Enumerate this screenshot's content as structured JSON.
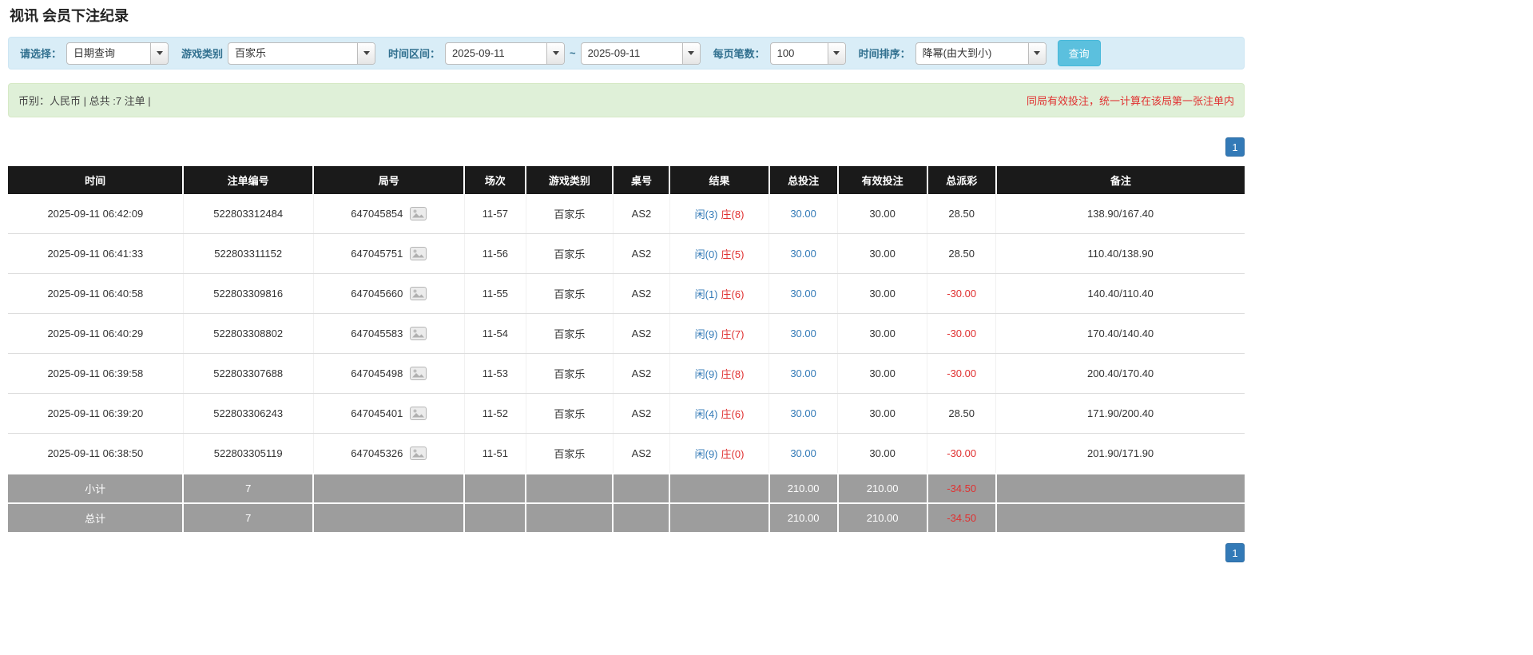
{
  "page": {
    "title": "视讯 会员下注纪录"
  },
  "colors": {
    "accent_blue": "#337ab7",
    "search_button_bg": "#5bc0de",
    "filter_bar_bg": "#d9edf7",
    "filter_label": "#31708f",
    "summary_bar_bg": "#dff0d8",
    "negative_red": "#e03131",
    "player_blue": "#337ab7",
    "banker_red": "#e03131",
    "table_header_bg": "#1a1a1a",
    "table_footer_bg": "#9d9d9d"
  },
  "filters": {
    "select_label": "请选择：",
    "select_value": "日期查询",
    "game_type_label": "游戏类别",
    "game_type_value": "百家乐",
    "date_range_label": "时间区间：",
    "date_from": "2025-09-11",
    "date_separator": "~",
    "date_to": "2025-09-11",
    "page_size_label": "每页笔数：",
    "page_size_value": "100",
    "sort_label": "时间排序：",
    "sort_value": "降幂(由大到小)",
    "search_button": "查询"
  },
  "summary": {
    "left": "币别：人民币 | 总共 :7 注单 |",
    "right": "同局有效投注，统一计算在该局第一张注单内"
  },
  "pagination": {
    "page": "1"
  },
  "table": {
    "headers": [
      "时间",
      "注单编号",
      "局号",
      "场次",
      "游戏类别",
      "桌号",
      "结果",
      "总投注",
      "有效投注",
      "总派彩",
      "备注"
    ],
    "rows": [
      {
        "time": "2025-09-11 06:42:09",
        "bet_id": "522803312484",
        "round_id": "647045854",
        "session": "11-57",
        "game": "百家乐",
        "table_no": "AS2",
        "result_player": "闲(3)",
        "result_banker": "庄(8)",
        "total_bet": "30.00",
        "valid_bet": "30.00",
        "payout": "28.50",
        "remark": "138.90/167.40"
      },
      {
        "time": "2025-09-11 06:41:33",
        "bet_id": "522803311152",
        "round_id": "647045751",
        "session": "11-56",
        "game": "百家乐",
        "table_no": "AS2",
        "result_player": "闲(0)",
        "result_banker": "庄(5)",
        "total_bet": "30.00",
        "valid_bet": "30.00",
        "payout": "28.50",
        "remark": "110.40/138.90"
      },
      {
        "time": "2025-09-11 06:40:58",
        "bet_id": "522803309816",
        "round_id": "647045660",
        "session": "11-55",
        "game": "百家乐",
        "table_no": "AS2",
        "result_player": "闲(1)",
        "result_banker": "庄(6)",
        "total_bet": "30.00",
        "valid_bet": "30.00",
        "payout": "-30.00",
        "remark": "140.40/110.40"
      },
      {
        "time": "2025-09-11 06:40:29",
        "bet_id": "522803308802",
        "round_id": "647045583",
        "session": "11-54",
        "game": "百家乐",
        "table_no": "AS2",
        "result_player": "闲(9)",
        "result_banker": "庄(7)",
        "total_bet": "30.00",
        "valid_bet": "30.00",
        "payout": "-30.00",
        "remark": "170.40/140.40"
      },
      {
        "time": "2025-09-11 06:39:58",
        "bet_id": "522803307688",
        "round_id": "647045498",
        "session": "11-53",
        "game": "百家乐",
        "table_no": "AS2",
        "result_player": "闲(9)",
        "result_banker": "庄(8)",
        "total_bet": "30.00",
        "valid_bet": "30.00",
        "payout": "-30.00",
        "remark": "200.40/170.40"
      },
      {
        "time": "2025-09-11 06:39:20",
        "bet_id": "522803306243",
        "round_id": "647045401",
        "session": "11-52",
        "game": "百家乐",
        "table_no": "AS2",
        "result_player": "闲(4)",
        "result_banker": "庄(6)",
        "total_bet": "30.00",
        "valid_bet": "30.00",
        "payout": "28.50",
        "remark": "171.90/200.40"
      },
      {
        "time": "2025-09-11 06:38:50",
        "bet_id": "522803305119",
        "round_id": "647045326",
        "session": "11-51",
        "game": "百家乐",
        "table_no": "AS2",
        "result_player": "闲(9)",
        "result_banker": "庄(0)",
        "total_bet": "30.00",
        "valid_bet": "30.00",
        "payout": "-30.00",
        "remark": "201.90/171.90"
      }
    ],
    "subtotal": {
      "label": "小计",
      "count": "7",
      "total_bet": "210.00",
      "valid_bet": "210.00",
      "payout": "-34.50"
    },
    "total": {
      "label": "总计",
      "count": "7",
      "total_bet": "210.00",
      "valid_bet": "210.00",
      "payout": "-34.50"
    }
  }
}
